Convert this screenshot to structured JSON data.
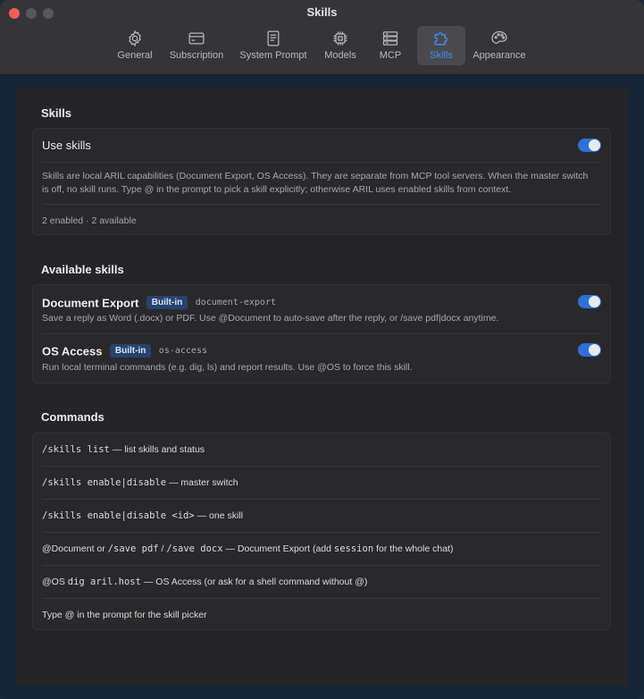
{
  "window": {
    "title": "Skills"
  },
  "tabs": [
    {
      "label": "General",
      "icon": "gear-icon"
    },
    {
      "label": "Subscription",
      "icon": "credit-card-icon"
    },
    {
      "label": "System Prompt",
      "icon": "document-icon"
    },
    {
      "label": "Models",
      "icon": "chip-icon"
    },
    {
      "label": "MCP",
      "icon": "server-icon"
    },
    {
      "label": "Skills",
      "icon": "puzzle-icon",
      "active": true
    },
    {
      "label": "Appearance",
      "icon": "palette-icon"
    }
  ],
  "skills_section": {
    "title": "Skills",
    "use_skills_label": "Use skills",
    "use_skills_enabled": true,
    "description": "Skills are local ARIL capabilities (Document Export, OS Access). They are separate from MCP tool servers. When the master switch is off, no skill runs. Type @ in the prompt to pick a skill explicitly; otherwise ARIL uses enabled skills from context.",
    "status": "2 enabled · 2 available"
  },
  "available_section": {
    "title": "Available skills",
    "skills": [
      {
        "name": "Document Export",
        "badge": "Built-in",
        "id": "document-export",
        "description": "Save a reply as Word (.docx) or PDF. Use @Document to auto-save after the reply, or /save pdf|docx anytime.",
        "enabled": true
      },
      {
        "name": "OS Access",
        "badge": "Built-in",
        "id": "os-access",
        "description": "Run local terminal commands (e.g. dig, ls) and report results. Use @OS to force this skill.",
        "enabled": true
      }
    ]
  },
  "commands_section": {
    "title": "Commands",
    "rows": [
      {
        "parts": [
          {
            "t": "/skills list",
            "mono": true
          },
          {
            "t": " — list skills and status",
            "mono": false
          }
        ]
      },
      {
        "parts": [
          {
            "t": "/skills enable|disable",
            "mono": true
          },
          {
            "t": " — master switch",
            "mono": false
          }
        ]
      },
      {
        "parts": [
          {
            "t": "/skills enable|disable <id>",
            "mono": true
          },
          {
            "t": " — one skill",
            "mono": false
          }
        ]
      },
      {
        "parts": [
          {
            "t": "@Document or ",
            "mono": false
          },
          {
            "t": "/save pdf",
            "mono": true
          },
          {
            "t": " / ",
            "mono": false
          },
          {
            "t": "/save docx",
            "mono": true
          },
          {
            "t": " — Document Export (add ",
            "mono": false
          },
          {
            "t": "session",
            "mono": true
          },
          {
            "t": " for the whole chat)",
            "mono": false
          }
        ]
      },
      {
        "parts": [
          {
            "t": "@OS ",
            "mono": false
          },
          {
            "t": "dig aril.host",
            "mono": true
          },
          {
            "t": " — OS Access (or ask for a shell command without @)",
            "mono": false
          }
        ]
      },
      {
        "parts": [
          {
            "t": "Type @ in the prompt for the skill picker",
            "mono": false
          }
        ]
      }
    ]
  },
  "colors": {
    "accent": "#3d8ef7",
    "toggle_on": "#2f6fd6",
    "badge_bg": "#27436e",
    "close_button": "#ec5f57"
  }
}
